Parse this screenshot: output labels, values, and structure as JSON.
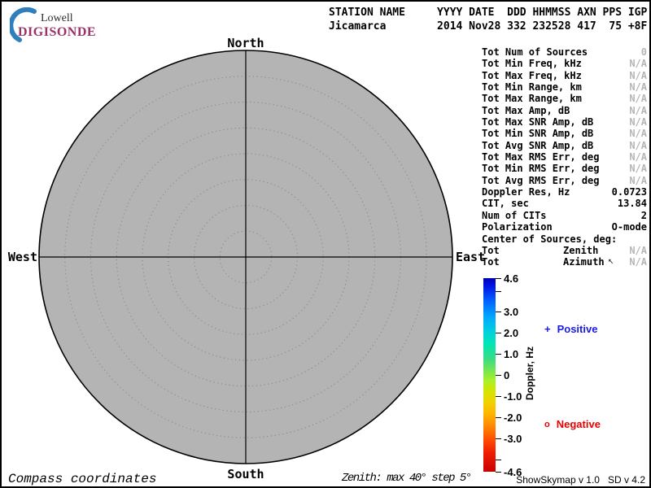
{
  "logo": {
    "line1": "Lowell",
    "line2": "DIGISONDE"
  },
  "header": {
    "line1": "STATION NAME     YYYY DATE  DDD HHMMSS AXN PPS IGP",
    "line2": "Jicamarca        2014 Nov28 332 232528 417  75 +8F",
    "station": "Jicamarca",
    "year": "2014",
    "date": "Nov28",
    "ddd": "332",
    "hhmmss": "232528",
    "axn": "417",
    "pps": "75",
    "igp": "+8F"
  },
  "compass": {
    "north": "North",
    "south": "South",
    "west": "West",
    "east": "East"
  },
  "stats": {
    "rows": [
      {
        "label": "Tot Num of Sources",
        "mid": "",
        "value": "0"
      },
      {
        "label": "Tot Min Freq, kHz",
        "mid": "",
        "value": "N/A"
      },
      {
        "label": "Tot Max Freq, kHz",
        "mid": "",
        "value": "N/A"
      },
      {
        "label": "Tot Min Range, km",
        "mid": "",
        "value": "N/A"
      },
      {
        "label": "Tot Max Range, km",
        "mid": "",
        "value": "N/A"
      },
      {
        "label": "Tot Max Amp, dB",
        "mid": "",
        "value": "N/A"
      },
      {
        "label": "Tot Max SNR Amp, dB",
        "mid": "",
        "value": "N/A"
      },
      {
        "label": "Tot Min SNR Amp, dB",
        "mid": "",
        "value": "N/A"
      },
      {
        "label": "Tot Avg SNR Amp, dB",
        "mid": "",
        "value": "N/A"
      },
      {
        "label": "Tot Max RMS Err, deg",
        "mid": "",
        "value": "N/A"
      },
      {
        "label": "Tot Min RMS Err, deg",
        "mid": "",
        "value": "N/A"
      },
      {
        "label": "Tot Avg RMS Err, deg",
        "mid": "",
        "value": "N/A"
      },
      {
        "label": "Doppler Res, Hz",
        "mid": "",
        "value": "0.0723"
      },
      {
        "label": "CIT, sec",
        "mid": "",
        "value": "13.84"
      },
      {
        "label": "Num of CITs",
        "mid": "",
        "value": "2"
      },
      {
        "label": "Polarization",
        "mid": "",
        "value": "O-mode"
      },
      {
        "label": "Center of Sources, deg:",
        "mid": "",
        "value": ""
      },
      {
        "label": "Tot",
        "mid": "Zenith",
        "value": "N/A"
      },
      {
        "label": "Tot",
        "mid": "Azimuth",
        "value": "N/A"
      }
    ]
  },
  "colorbar": {
    "title": "Doppler, Hz",
    "max": 4.6,
    "min": -4.6,
    "ticks": [
      "4.6",
      "3.0",
      "2.0",
      "1.0",
      "0",
      "-1.0",
      "-2.0",
      "-3.0",
      "-4.6"
    ]
  },
  "legend": {
    "positive_symbol": "+",
    "positive_label": "Positive",
    "negative_symbol": "o",
    "negative_label": "Negative"
  },
  "footer": {
    "coords": "Compass coordinates",
    "zenith": "Zenith: max 40°  step 5°",
    "version": "ShowSkymap v 1.0   SD v 4.2"
  },
  "skymap": {
    "zenith_max_deg": 40,
    "zenith_step_deg": 5,
    "num_sources": 0
  },
  "cursor_glyph": "↖",
  "colors": {
    "circle_fill": "#b4b4b4",
    "dim_text": "#b5b5b5",
    "positive_blue": "#1a1ae6",
    "negative_red": "#e60000",
    "digisonde_brand": "#993366",
    "cbar_top": "#0000b4",
    "cbar_bottom": "#c80000"
  }
}
